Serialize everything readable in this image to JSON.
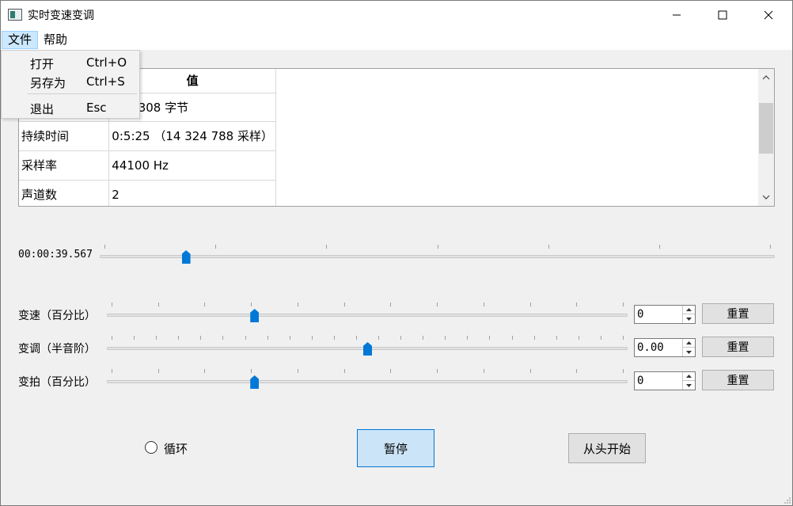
{
  "window": {
    "title": "实时变速变调",
    "min_icon": "minimize-icon",
    "max_icon": "maximize-icon",
    "close_icon": "close-icon"
  },
  "menubar": {
    "file": "文件",
    "help": "帮助"
  },
  "file_menu": [
    {
      "label": "打开",
      "shortcut": "Ctrl+O"
    },
    {
      "label": "另存为",
      "shortcut": "Ctrl+S"
    },
    {
      "label": "退出",
      "shortcut": "Esc"
    }
  ],
  "table": {
    "header_name": "",
    "header_value": "值",
    "rows": [
      {
        "name": "",
        "value": "299 308 字节"
      },
      {
        "name": "持续时间",
        "value": "0:5:25 （14 324 788 采样）"
      },
      {
        "name": "采样率",
        "value": "44100 Hz"
      },
      {
        "name": "声道数",
        "value": "2"
      }
    ]
  },
  "position": {
    "time": "00:00:39.567",
    "progress_fraction": 0.122
  },
  "controls": [
    {
      "label": "变速（百分比）",
      "value": "0",
      "reset": "重置",
      "handle_fraction": 0.279
    },
    {
      "label": "变调（半音阶）",
      "value": "0.00",
      "reset": "重置",
      "handle_fraction": 0.5
    },
    {
      "label": "变拍（百分比）",
      "value": "0",
      "reset": "重置",
      "handle_fraction": 0.279
    }
  ],
  "bottom": {
    "loop_label": "循环",
    "pause_label": "暂停",
    "restart_label": "从头开始"
  },
  "colors": {
    "accent": "#0078d7",
    "menu_highlight": "#cce8ff",
    "pause_bg": "#cce4f7"
  }
}
